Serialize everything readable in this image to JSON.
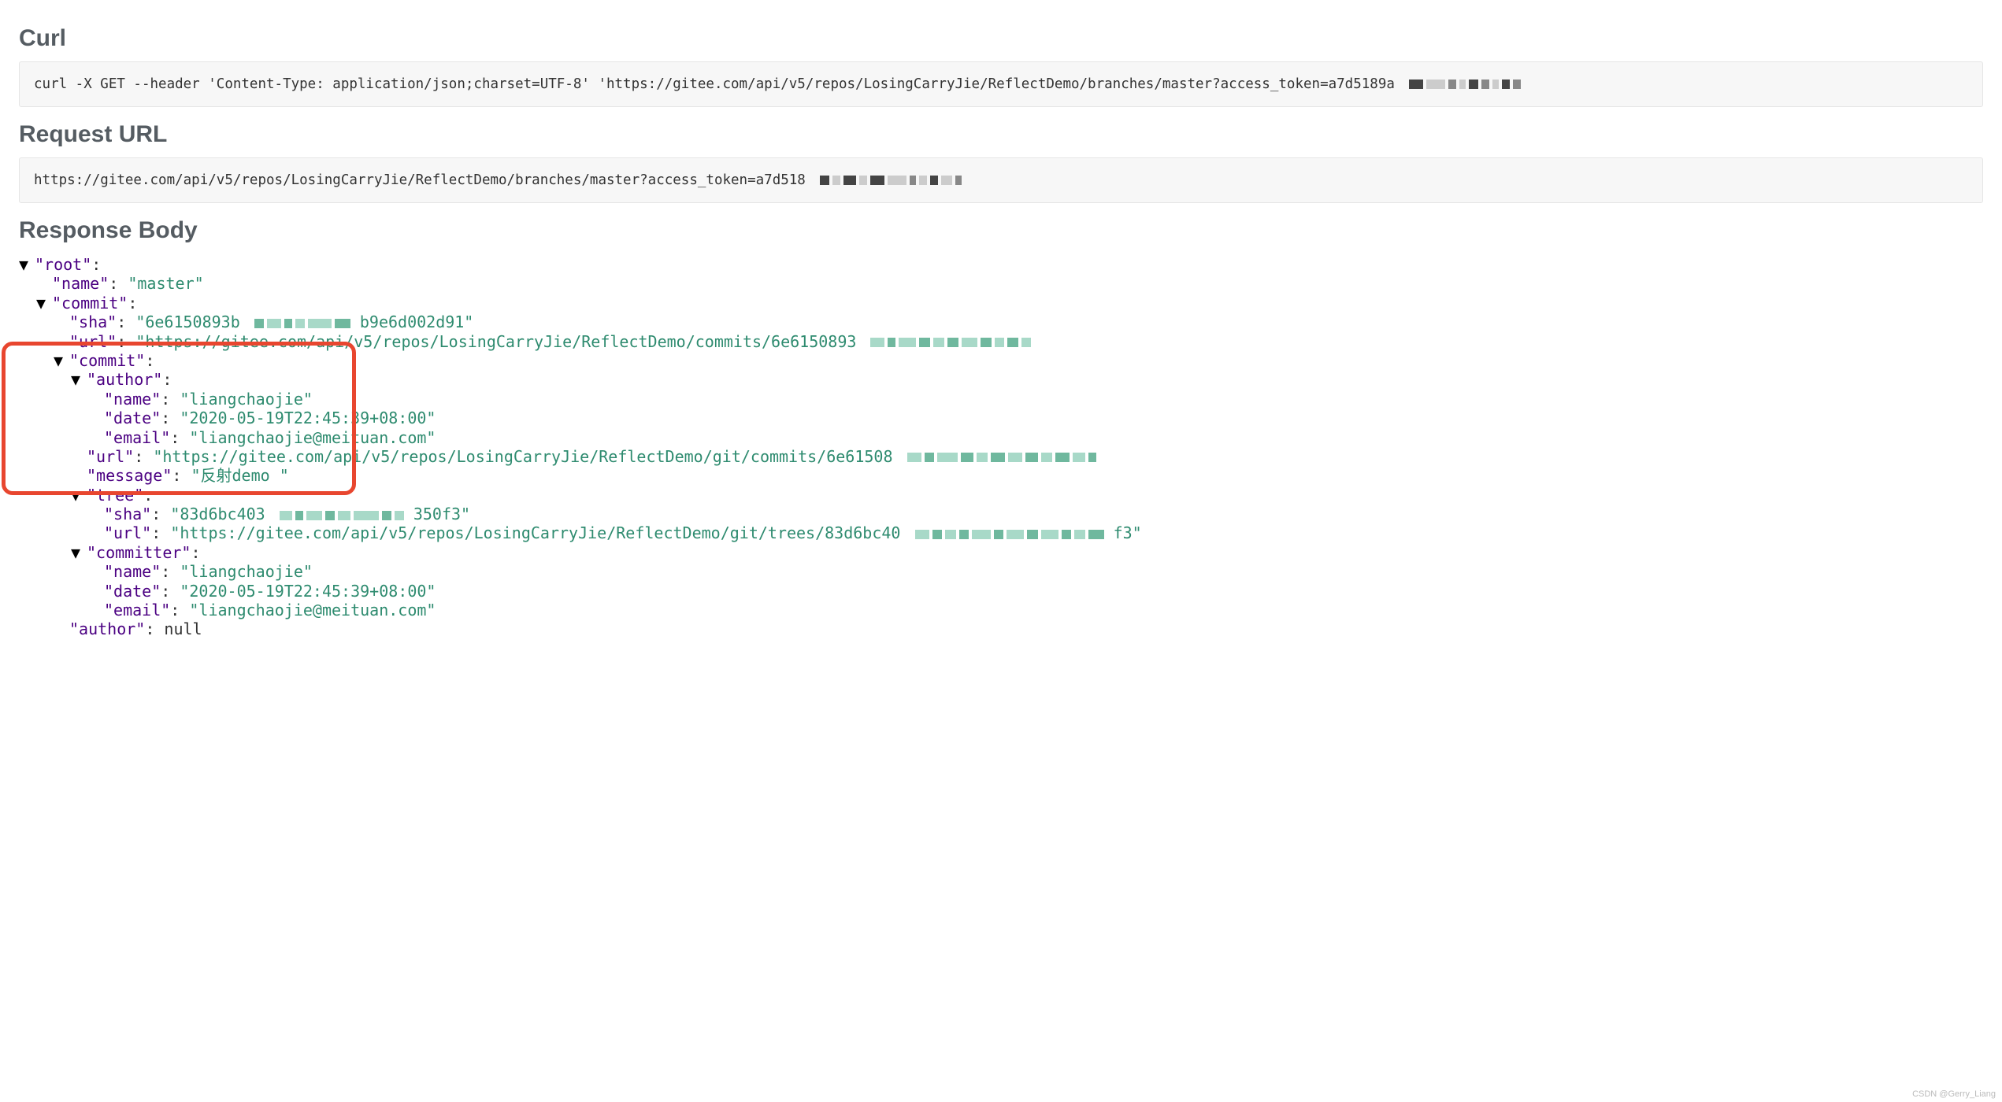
{
  "sections": {
    "curl_title": "Curl",
    "curl_cmd": "curl -X GET --header 'Content-Type: application/json;charset=UTF-8' 'https://gitee.com/api/v5/repos/LosingCarryJie/ReflectDemo/branches/master?access_token=a7d5189a",
    "request_url_title": "Request URL",
    "request_url": "https://gitee.com/api/v5/repos/LosingCarryJie/ReflectDemo/branches/master?access_token=a7d518",
    "response_body_title": "Response Body"
  },
  "json": {
    "root_key": "\"root\"",
    "name_key": "\"name\"",
    "name_val": "\"master\"",
    "commit_key": "\"commit\"",
    "sha_key": "\"sha\"",
    "sha_val_pre": "\"6e6150893b",
    "sha_val_post": "b9e6d002d91\"",
    "url_key": "\"url\"",
    "url_val_pre": "\"https://gitee.com/api/v5/repos/LosingCarryJie/ReflectDemo/commits/6e6150893",
    "inner_commit_key": "\"commit\"",
    "author_key": "\"author\"",
    "author_name_val": "\"liangchaojie\"",
    "date_key": "\"date\"",
    "date_val": "\"2020-05-19T22:45:39+08:00\"",
    "email_key": "\"email\"",
    "email_val": "\"liangchaojie@meituan.com\"",
    "inner_url_val_pre": "\"https://gitee.com/api/v5/repos/LosingCarryJie/ReflectDemo/git/commits/6e61508",
    "message_key": "\"message\"",
    "message_val": "\"反射demo \"",
    "tree_key": "\"tree\"",
    "tree_sha_val_pre": "\"83d6bc403",
    "tree_sha_val_post": "350f3\"",
    "tree_url_val_pre": "\"https://gitee.com/api/v5/repos/LosingCarryJie/ReflectDemo/git/trees/83d6bc40",
    "tree_url_val_post": "f3\"",
    "committer_key": "\"committer\"",
    "committer_name_val": "\"liangchaojie\"",
    "committer_date_val": "\"2020-05-19T22:45:39+08:00\"",
    "committer_email_val": "\"liangchaojie@meituan.com\"",
    "outer_author_key": "\"author\"",
    "null_val": "null"
  },
  "watermark": "CSDN @Gerry_Liang"
}
